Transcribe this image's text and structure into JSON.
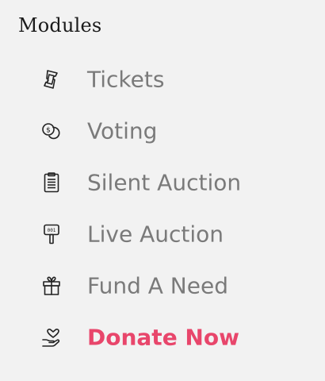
{
  "section": {
    "title": "Modules"
  },
  "menu": {
    "items": [
      {
        "label": "Tickets",
        "icon": "ticket-icon"
      },
      {
        "label": "Voting",
        "icon": "coins-icon"
      },
      {
        "label": "Silent Auction",
        "icon": "clipboard-icon"
      },
      {
        "label": "Live Auction",
        "icon": "bid-paddle-icon"
      },
      {
        "label": "Fund A Need",
        "icon": "gift-icon"
      },
      {
        "label": "Donate Now",
        "icon": "heart-hand-icon",
        "active": true
      }
    ]
  },
  "colors": {
    "background": "#f2f2f2",
    "title": "#1a1a1a",
    "item": "#7a7a7a",
    "active": "#e8466b"
  }
}
